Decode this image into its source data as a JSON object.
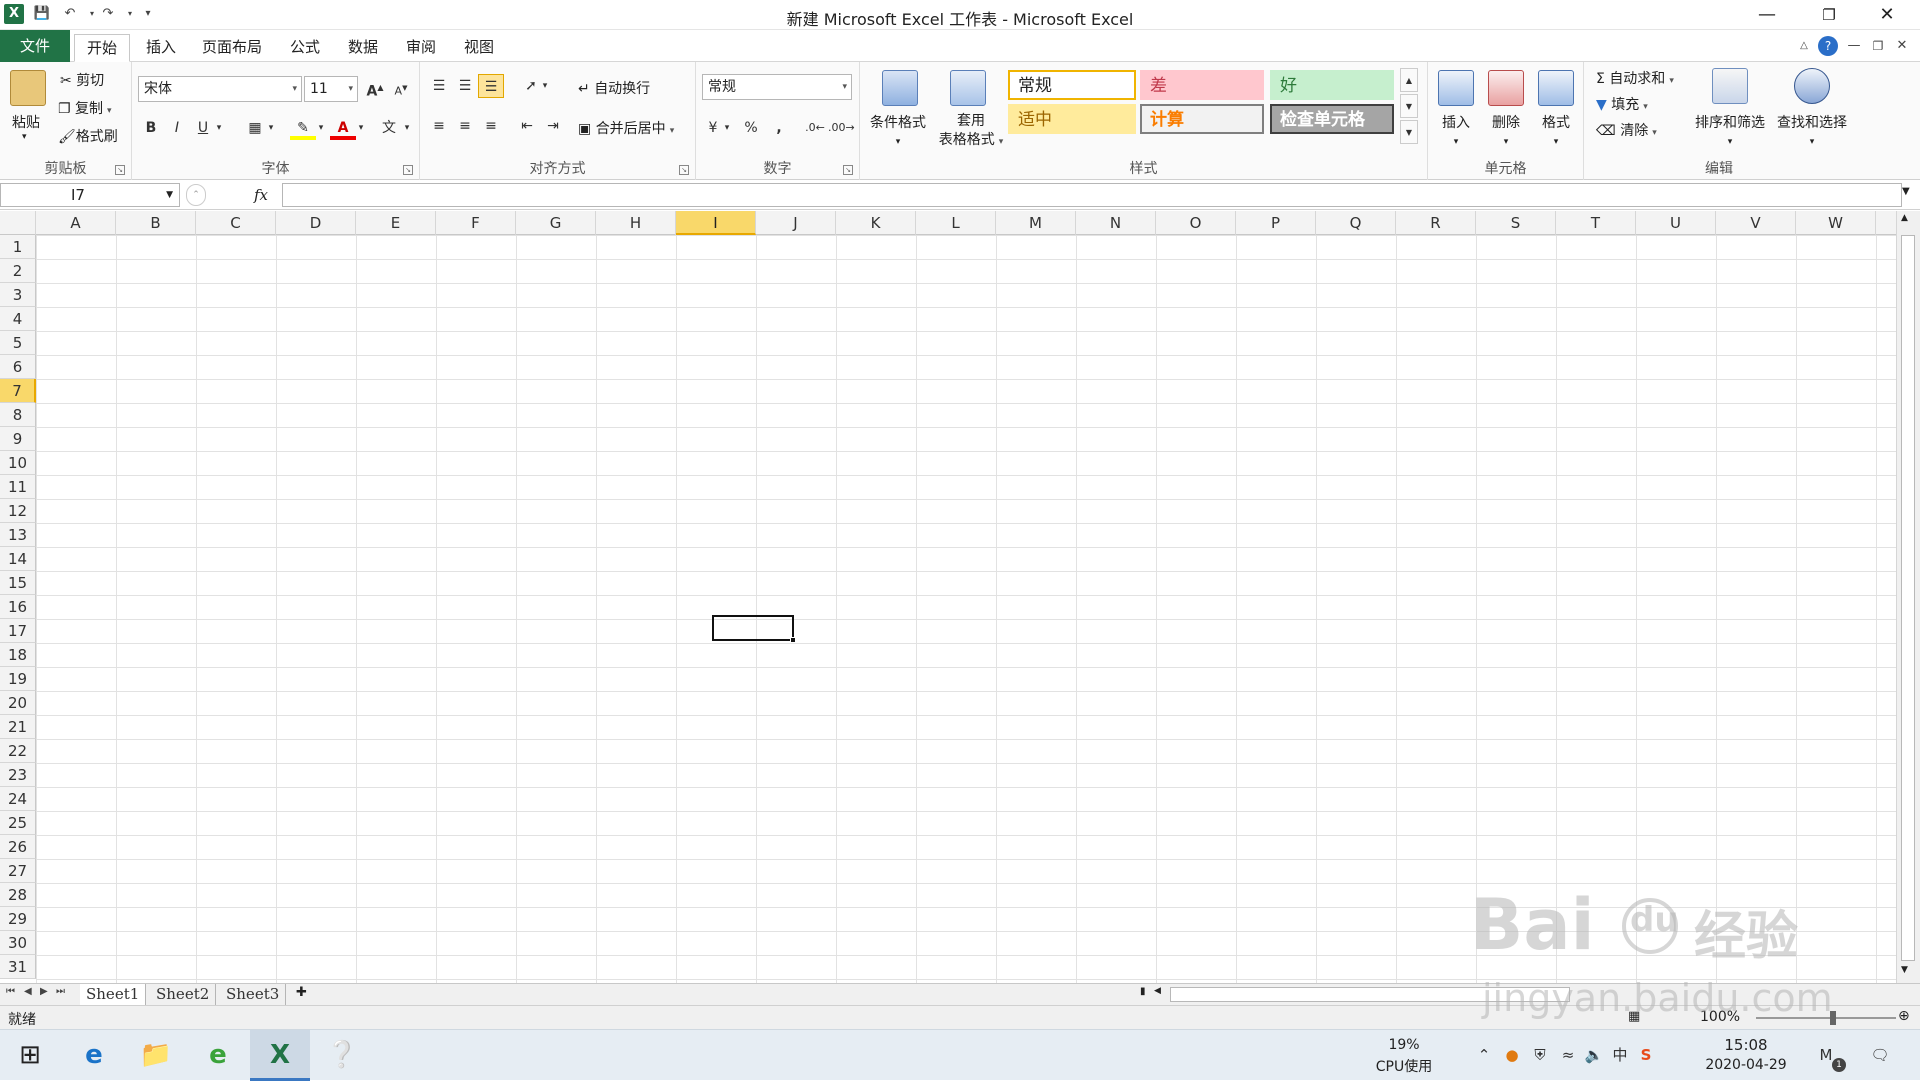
{
  "titlebar": {
    "title": "新建 Microsoft Excel 工作表 - Microsoft Excel",
    "qat": [
      "excel-logo",
      "save",
      "undo",
      "redo",
      "customize"
    ]
  },
  "tabs": [
    {
      "label": "文件"
    },
    {
      "label": "开始"
    },
    {
      "label": "插入"
    },
    {
      "label": "页面布局"
    },
    {
      "label": "公式"
    },
    {
      "label": "数据"
    },
    {
      "label": "审阅"
    },
    {
      "label": "视图"
    }
  ],
  "ribbon": {
    "clipboard": {
      "label": "剪贴板",
      "paste": "粘贴",
      "cut": "剪切",
      "copy": "复制",
      "format_painter": "格式刷"
    },
    "font": {
      "label": "字体",
      "font_name": "宋体",
      "font_size": "11",
      "bold": "B",
      "italic": "I",
      "underline": "U",
      "grow": "A",
      "shrink": "A"
    },
    "alignment": {
      "label": "对齐方式",
      "wrap": "自动换行",
      "merge": "合并后居中"
    },
    "number": {
      "label": "数字",
      "format": "常规",
      "percent": "%",
      "comma": ","
    },
    "styles": {
      "label": "样式",
      "conditional": "条件格式",
      "table_line1": "套用",
      "table_line2": "表格格式",
      "cells": [
        {
          "text": "常规",
          "bg": "#ffffff",
          "fg": "#222222",
          "border": "#f0b400"
        },
        {
          "text": "差",
          "bg": "#ffc7ce",
          "fg": "#c0394b",
          "border": "#ffc7ce"
        },
        {
          "text": "好",
          "bg": "#c6efce",
          "fg": "#2d7a3a",
          "border": "#c6efce"
        },
        {
          "text": "适中",
          "bg": "#ffeb9c",
          "fg": "#9c6500",
          "border": "#ffeb9c"
        },
        {
          "text": "计算",
          "bg": "#f2f2f2",
          "fg": "#fa7d00",
          "border": "#7f7f7f"
        },
        {
          "text": "检查单元格",
          "bg": "#a5a5a5",
          "fg": "#ffffff",
          "border": "#3f3f3f"
        }
      ]
    },
    "cells": {
      "label": "单元格",
      "insert": "插入",
      "delete": "删除",
      "format": "格式"
    },
    "editing": {
      "label": "编辑",
      "autosum": "自动求和",
      "fill": "填充",
      "clear": "清除",
      "sort": "排序和筛选",
      "find": "查找和选择"
    }
  },
  "formula": {
    "namebox": "I7",
    "fx": "fx"
  },
  "grid": {
    "columns": [
      "A",
      "B",
      "C",
      "D",
      "E",
      "F",
      "G",
      "H",
      "I",
      "J",
      "K",
      "L",
      "M",
      "N",
      "O",
      "P",
      "Q",
      "R",
      "S",
      "T",
      "U",
      "V",
      "W"
    ],
    "rows": [
      "1",
      "2",
      "3",
      "4",
      "5",
      "6",
      "7",
      "8",
      "9",
      "10",
      "11",
      "12",
      "13",
      "14",
      "15",
      "16",
      "17",
      "18",
      "19",
      "20",
      "21",
      "22",
      "23",
      "24",
      "25",
      "26",
      "27",
      "28",
      "29",
      "30",
      "31"
    ],
    "selected_col": "I",
    "selected_row": "7"
  },
  "sheets": [
    {
      "name": "Sheet1"
    },
    {
      "name": "Sheet2"
    },
    {
      "name": "Sheet3"
    }
  ],
  "status": {
    "ready": "就绪",
    "zoom": "100%"
  },
  "taskbar": {
    "cpu_pct": "19%",
    "cpu_label": "CPU使用",
    "time": "15:08",
    "date": "2020-04-29",
    "ime": "中",
    "notif_count": "1"
  },
  "watermark": {
    "line1": "Bai",
    "line2": "du",
    "line3": "经验",
    "line4": "jingyan.baidu.com"
  }
}
